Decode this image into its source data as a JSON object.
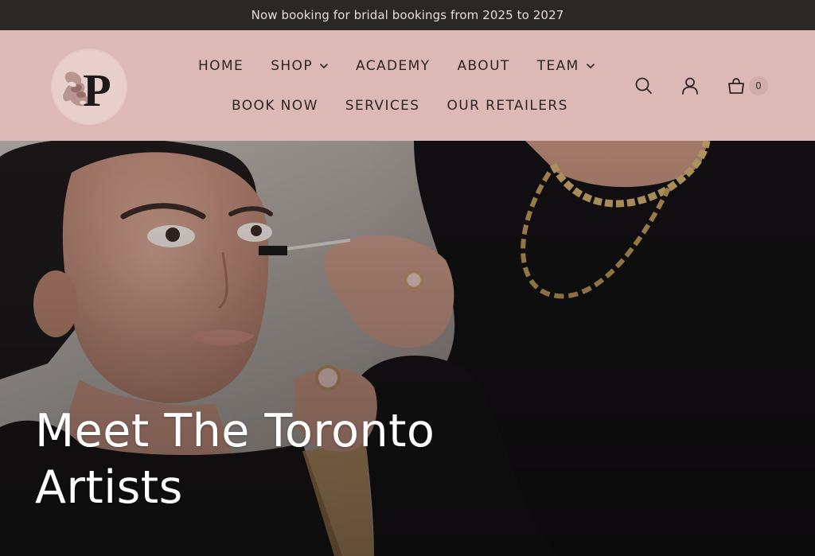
{
  "announcement": {
    "text": "Now booking for bridal bookings from 2025 to 2027"
  },
  "header": {
    "logo_icon": "p-monogram-floral-logo",
    "nav_row1": [
      {
        "label": "HOME",
        "has_dropdown": false
      },
      {
        "label": "SHOP",
        "has_dropdown": true
      },
      {
        "label": "ACADEMY",
        "has_dropdown": false
      },
      {
        "label": "ABOUT",
        "has_dropdown": false
      },
      {
        "label": "TEAM",
        "has_dropdown": true
      }
    ],
    "nav_row2": [
      {
        "label": "BOOK NOW",
        "has_dropdown": false
      },
      {
        "label": "SERVICES",
        "has_dropdown": false
      },
      {
        "label": "OUR RETAILERS",
        "has_dropdown": false
      }
    ],
    "icons": [
      "search-icon",
      "account-icon",
      "cart-icon"
    ],
    "cart_count": "0"
  },
  "hero": {
    "title_line1": "Meet The Toronto",
    "title_line2": "Artists"
  },
  "colors": {
    "announcement_bg": "#2a2726",
    "header_bg": "#dcb9b6",
    "nav_text": "#2b2526",
    "hero_text": "#ffffff"
  }
}
